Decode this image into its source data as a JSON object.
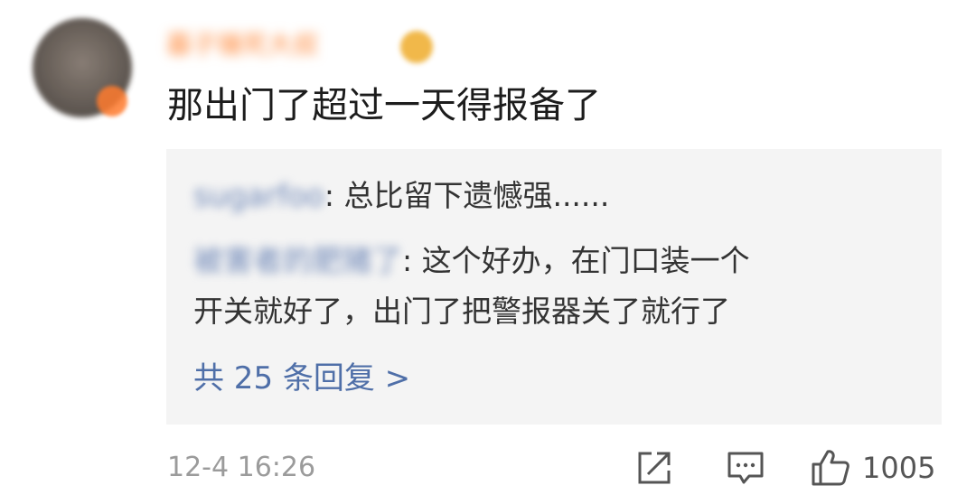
{
  "comment": {
    "username": "暮子锤死大叔",
    "text": "那出门了超过一天得报备了",
    "timestamp": "12-4 16:26",
    "like_count": "1005"
  },
  "replies": [
    {
      "user": "sugarfoo",
      "text": ": 总比留下遗憾强......"
    },
    {
      "user": "被害者的肥猪了",
      "text": ": 这个好办，在门口装一个",
      "text_cont": "开关就好了，出门了把警报器关了就行了"
    }
  ],
  "more_replies_label": "共 25 条回复 >",
  "icons": {
    "share": "share-icon",
    "comment": "comment-icon",
    "like": "thumbs-up-icon"
  },
  "colors": {
    "username": "#ff8a3d",
    "link": "#4f6fa8",
    "reply_bg": "#f4f4f4",
    "meta": "#9b9b9b"
  }
}
